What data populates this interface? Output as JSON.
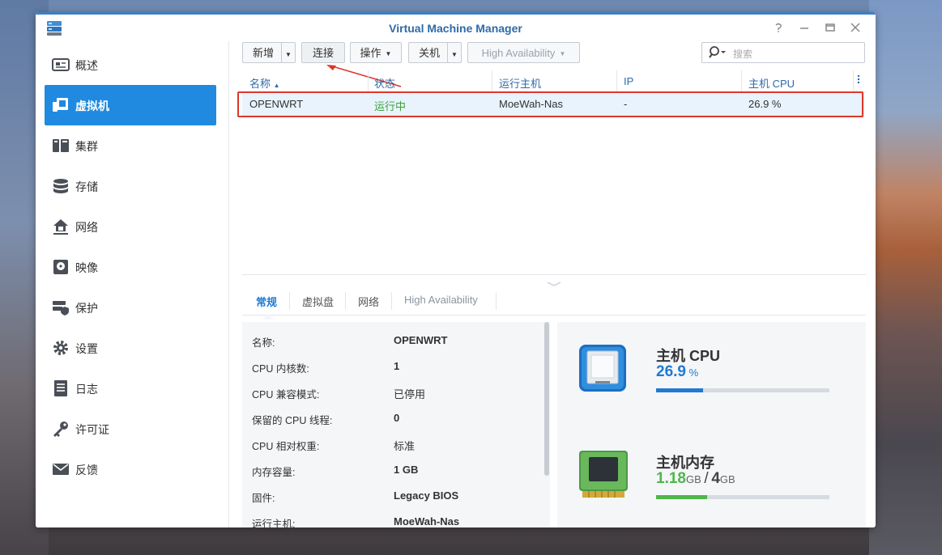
{
  "window": {
    "title": "Virtual Machine Manager"
  },
  "colors": {
    "accent": "#1f8ae0",
    "running": "#3aa23a",
    "highlight_box": "#e0362b",
    "cpu_bar": "#1f7ad1",
    "mem_bar": "#4fb64a"
  },
  "sidebar": {
    "items": [
      {
        "label": "概述",
        "icon": "overview-icon"
      },
      {
        "label": "虚拟机",
        "icon": "virtual-machine-icon",
        "active": true
      },
      {
        "label": "集群",
        "icon": "cluster-icon"
      },
      {
        "label": "存储",
        "icon": "storage-icon"
      },
      {
        "label": "网络",
        "icon": "network-icon"
      },
      {
        "label": "映像",
        "icon": "image-icon"
      },
      {
        "label": "保护",
        "icon": "protection-icon"
      },
      {
        "label": "设置",
        "icon": "gear-icon"
      },
      {
        "label": "日志",
        "icon": "log-icon"
      },
      {
        "label": "许可证",
        "icon": "key-icon"
      },
      {
        "label": "反馈",
        "icon": "mail-icon"
      }
    ]
  },
  "toolbar": {
    "create": "新增",
    "connect": "连接",
    "action": "操作",
    "shutdown": "关机",
    "ha": "High Availability",
    "search_placeholder": "搜索"
  },
  "table": {
    "columns": [
      "名称",
      "状态",
      "运行主机",
      "IP",
      "主机 CPU"
    ],
    "rows": [
      {
        "name": "OPENWRT",
        "status": "运行中",
        "host": "MoeWah-Nas",
        "ip": "-",
        "cpu": "26.9 %"
      }
    ]
  },
  "tabs": [
    "常规",
    "虚拟盘",
    "网络",
    "High Availability"
  ],
  "properties": [
    {
      "label": "名称:",
      "value": "OPENWRT"
    },
    {
      "label": "CPU 内核数:",
      "value": "1"
    },
    {
      "label": "CPU 兼容模式:",
      "value": "已停用"
    },
    {
      "label": "保留的 CPU 线程:",
      "value": "0"
    },
    {
      "label": "CPU 相对权重:",
      "value": "标准"
    },
    {
      "label": "内存容量:",
      "value": "1 GB"
    },
    {
      "label": "固件:",
      "value": "Legacy BIOS"
    },
    {
      "label": "运行主机:",
      "value": "MoeWah-Nas"
    }
  ],
  "resources": {
    "cpu": {
      "title": "主机 CPU",
      "value": "26.9",
      "unit": "%",
      "fraction": 0.269
    },
    "memory": {
      "title": "主机内存",
      "used": "1.18",
      "used_unit": "GB",
      "sep": "/",
      "total": "4",
      "total_unit": "GB",
      "fraction": 0.295
    }
  }
}
